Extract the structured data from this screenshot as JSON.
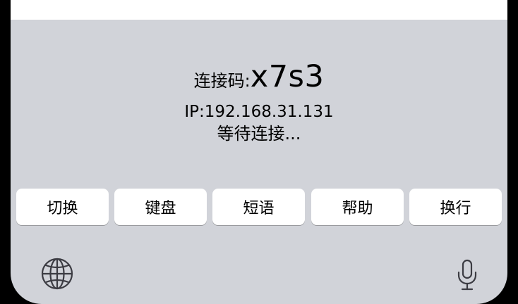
{
  "status": {
    "code_label": "连接码:",
    "code_value": "x7s3",
    "ip_text": "IP:192.168.31.131",
    "waiting_text": "等待连接..."
  },
  "keys": [
    {
      "label": "切换"
    },
    {
      "label": "键盘"
    },
    {
      "label": "短语"
    },
    {
      "label": "帮助"
    },
    {
      "label": "换行"
    }
  ],
  "icons": {
    "globe": "globe-icon",
    "mic": "microphone-icon"
  },
  "colors": {
    "keyboard_background": "#d1d3d9",
    "key_background": "#ffffff",
    "text": "#000000",
    "icon": "#3c3c43"
  }
}
